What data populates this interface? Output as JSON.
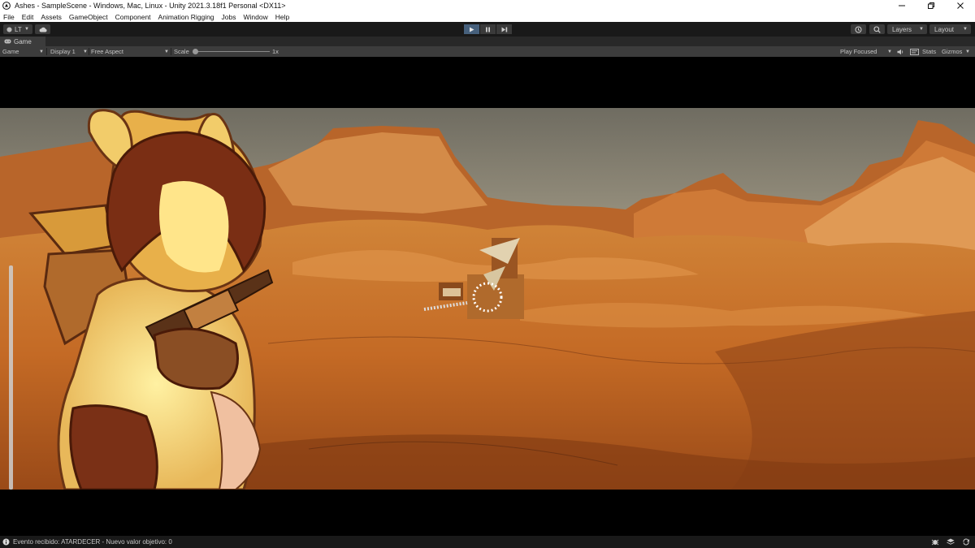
{
  "window": {
    "title": "Ashes - SampleScene - Windows, Mac, Linux - Unity 2021.3.18f1 Personal <DX11>",
    "controls": [
      "minimize-icon",
      "restore-icon",
      "close-icon"
    ]
  },
  "menu": {
    "items": [
      "File",
      "Edit",
      "Assets",
      "GameObject",
      "Component",
      "Animation Rigging",
      "Jobs",
      "Window",
      "Help"
    ]
  },
  "toolbar": {
    "account_label": "LT",
    "cloud_icon": "cloud-icon",
    "play_controls": [
      "play-icon",
      "pause-icon",
      "step-icon"
    ],
    "layers_label": "Layers",
    "layout_label": "Layout",
    "history_icon": "history-icon",
    "search_icon": "search-icon"
  },
  "game_view": {
    "tab_label": "Game",
    "view_select": "Game",
    "display_select": "Display 1",
    "aspect_select": "Free Aspect",
    "scale_label": "Scale",
    "scale_value": "1x",
    "scale_fraction": 0.0,
    "play_mode_select": "Play Focused",
    "stats_label": "Stats",
    "gizmos_label": "Gizmos"
  },
  "status": {
    "message": "Evento recibido: ATARDECER - Nuevo valor objetivo: 0"
  },
  "colors": {
    "editor_dark": "#191919",
    "panel": "#3c3c3c",
    "play_active": "#46607c",
    "sky": "#7e7a6c",
    "desert": "#c8702c",
    "shadow": "#7a3a16"
  }
}
